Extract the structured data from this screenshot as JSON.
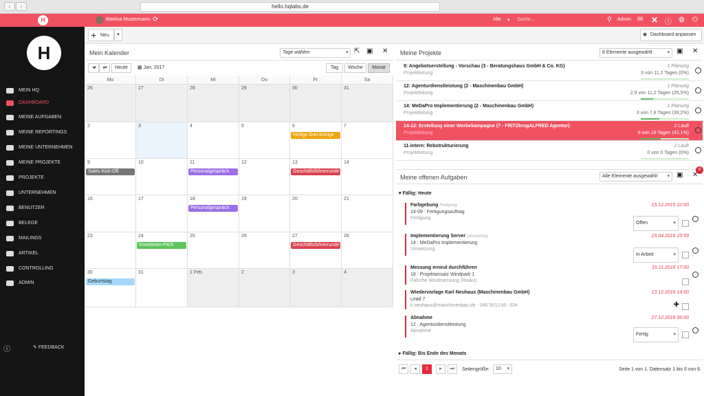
{
  "browser": {
    "url": "hello.hqlabs.de",
    "back": "‹",
    "fwd": "›"
  },
  "topbar": {
    "user": "Martina Mustermann",
    "filter": "Alle",
    "search_placeholder": "Suche...",
    "admin": "Admin"
  },
  "sidebar": {
    "items": [
      {
        "label": "MEIN HQ",
        "icon": "home-icon"
      },
      {
        "label": "DASHBOARD",
        "icon": "dashboard-icon",
        "active": true
      },
      {
        "label": "MEINE AUFGABEN",
        "icon": "checkbox-icon"
      },
      {
        "label": "MEINE REPORTINGS",
        "icon": "stopwatch-icon"
      },
      {
        "label": "MEINE UNTERNEHMEN",
        "icon": "building-icon"
      },
      {
        "label": "MEINE PROJEKTE",
        "icon": "folder-icon"
      },
      {
        "label": "PROJEKTE",
        "icon": "folders-icon"
      },
      {
        "label": "UNTERNEHMEN",
        "icon": "companies-icon"
      },
      {
        "label": "BENUTZER",
        "icon": "users-icon"
      },
      {
        "label": "BELEGE",
        "icon": "receipt-icon"
      },
      {
        "label": "MAILINGS",
        "icon": "mail-icon"
      },
      {
        "label": "ARTIKEL",
        "icon": "box-icon"
      },
      {
        "label": "CONTROLLING",
        "icon": "controlling-icon"
      },
      {
        "label": "ADMIN",
        "icon": "wrench-icon"
      }
    ],
    "feedback": "FEEDBACK"
  },
  "toolbar": {
    "new": "Neu",
    "dashboard_btn": "Dashboard anpassen"
  },
  "calendar": {
    "title": "Mein Kalender",
    "select": "Tage wählen",
    "today": "Heute",
    "month": "Jan, 2017",
    "views": [
      "Tag",
      "Woche",
      "Monat"
    ],
    "active_view": "Monat",
    "weekdays": [
      "Mo",
      "Di",
      "Mi",
      "Do",
      "Fr",
      "Sa"
    ],
    "weeks": [
      [
        "26",
        "27",
        "28",
        "29",
        "30",
        "31"
      ],
      [
        "2",
        "3",
        "4",
        "5",
        "6",
        "7"
      ],
      [
        "9",
        "10",
        "11",
        "12",
        "13",
        "14"
      ],
      [
        "16",
        "17",
        "18",
        "19",
        "20",
        "21"
      ],
      [
        "23",
        "24",
        "25",
        "26",
        "27",
        "28"
      ],
      [
        "30",
        "31",
        "1 Feb",
        "2",
        "3",
        "4"
      ]
    ],
    "events": [
      {
        "label": "Heilige Drei Könige",
        "color": "#f0a30a"
      },
      {
        "label": "Sales Kick-Off",
        "color": "#777777"
      },
      {
        "label": "Personalgespräch",
        "color": "#9b6fe6"
      },
      {
        "label": "Geschäftsführerrunde",
        "color": "#d9434f"
      },
      {
        "label": "Personalgespräch",
        "color": "#9b6fe6"
      },
      {
        "label": "Investoren-Pitch",
        "color": "#5ec45e"
      },
      {
        "label": "Geschäftsführerrunde",
        "color": "#d9434f"
      },
      {
        "label": "Geburtstag",
        "color": "#a5d8f6"
      }
    ]
  },
  "projects": {
    "title": "Meine Projekte",
    "select": "8 Elemente ausgewählt",
    "rows": [
      {
        "title": "9: Angebotserstellung - Vorschau (3 - Beratungshaus GmbH & Co. KG)",
        "sub": "Projektleitung",
        "status": "1 Planung",
        "progress_text": "0 von 11,2 Tagen (0%)",
        "pct": 0
      },
      {
        "title": "12: Agenturdienstleistung (2 - Maschinenbau GmbH)",
        "sub": "Projektleitung",
        "status": "1 Planung",
        "progress_text": "2,9 von 11,2 Tagen (25,5%)",
        "pct": 25.5
      },
      {
        "title": "14: MeDaPro Implementierung (2 - Maschinenbau GmbH)",
        "sub": "Projektleitung",
        "status": "1 Planung",
        "progress_text": "3 von 7,8 Tagen (38,2%)",
        "pct": 38.2
      },
      {
        "title": "14-12: Erstellung einer Werbekampagne (7 - FRITZkrugALFRED Agentur)",
        "sub": "Projektleitung",
        "status": "2 Läuft",
        "progress_text": "8 von 19 Tagen (42,1%)",
        "pct": 42.1,
        "highlight": true
      },
      {
        "title": "11-intern: Rebstrukturierung",
        "sub": "Projektleitung",
        "status": "2 Läuft",
        "progress_text": "0 von 0 Tagen (0%)",
        "pct": 0
      }
    ]
  },
  "tasks": {
    "title": "Meine offenen Aufgaben",
    "select": "Alle Elemente ausgewählt",
    "badge": "6",
    "group_today": "Fällig: Heute",
    "group_month": "Fällig: Bis Ende des Monats",
    "items": [
      {
        "title": "Farbgebung",
        "tag": "Fertigung",
        "l2": "14-09 : Fertigungsauftrag",
        "l3": "Fertigung",
        "date": "15.12.2015 22:00",
        "status": "Offen"
      },
      {
        "title": "Implementierung Server",
        "tag": "Umsetzung",
        "l2": "14 : MeDaPro Implementierung",
        "l3": "Umsetzung",
        "date": "23.04.2016 23:59",
        "status": "In Arbeit"
      },
      {
        "title": "Messung erneut durchführen",
        "tag": "",
        "l2": "18 : Projektansatz Windpark 1",
        "l3": "Falsche Windmessung (Risiko)",
        "date": "16.11.2016 17:00",
        "status": ""
      },
      {
        "title": "Wiedervorlage Karl Neuhaus (Maschinenbau GmbH)",
        "tag": "",
        "l2": "Lead 7",
        "l3": "k.neuhaus@maschinenbau.de - 040 5612 66 -334",
        "date": "13.12.2016 14:00",
        "status": ""
      },
      {
        "title": "Abnahme",
        "tag": "",
        "l2": "12 : Agenturdienstleistung",
        "l3": "Abnahme",
        "date": "27.12.2016 00:00",
        "status": "Fertig"
      }
    ],
    "pager": {
      "page": "1",
      "size_label": "Seitengröße:",
      "size": "10",
      "info": "Seite 1 von 1. Datensatz 1 bis 6 von 6."
    }
  }
}
